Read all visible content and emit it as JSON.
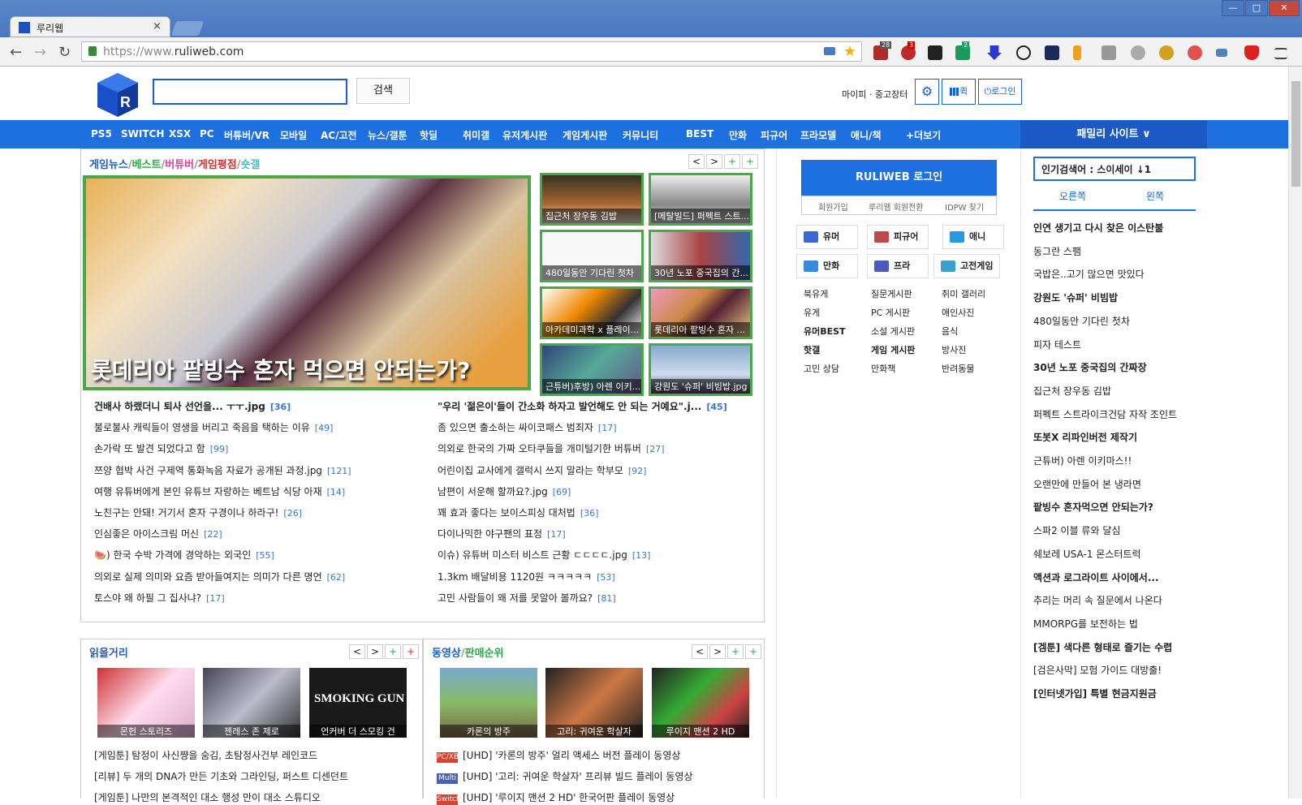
{
  "browser": {
    "tab_title": "루리웹",
    "tab_close": "×",
    "url_prefix": "https://www.",
    "url_domain": "ruliweb.com",
    "back": "←",
    "forward": "→",
    "reload": "↻",
    "star": "★",
    "win_min": "—",
    "win_max": "□",
    "win_close": "✕",
    "ext_badges": [
      "28",
      "3",
      "2"
    ]
  },
  "header": {
    "search_button": "검색",
    "search_placeholder": "",
    "mypi": "마이피 · 중고장터",
    "settings_icon": "⚙",
    "quick_label": "퀵",
    "login_label": "로그인"
  },
  "menu": {
    "items": [
      "PS5",
      "SWITCH",
      "XSX",
      "PC",
      "버튜버/VR",
      "모바일",
      "AC/고전",
      "뉴스/갤툰",
      "핫딜",
      "취미갤",
      "유저게시판",
      "게임게시판",
      "커뮤니티",
      "BEST",
      "만화",
      "피규어",
      "프라모델",
      "애니/책",
      "+더보기"
    ],
    "family": "패밀리 사이트 ∨"
  },
  "main": {
    "crumbs": [
      {
        "label": "게임뉴스",
        "color": "#1a5fd1"
      },
      {
        "label": "베스트",
        "color": "#2fa84a"
      },
      {
        "label": "버튜버",
        "color": "#e0409a"
      },
      {
        "label": "게임평점",
        "color": "#e02a2a"
      },
      {
        "label": "숏갤",
        "color": "#40c0c0"
      }
    ],
    "pager": [
      "<",
      ">",
      "+",
      "+"
    ],
    "hero_caption": "롯데리아 팥빙수 혼자 먹으면 안되는가?",
    "thumbs": [
      "집근처 장우동 김밥",
      "[메탈빌드] 퍼펙트 스트...",
      "480일동안 기다린 첫차",
      "30년 노포 중국집의 간...",
      "아카데미과학 x 플레이...",
      "롯데리아 팥빙수 혼자 ...",
      "근튜버)후방) 아렌 이키...",
      "강원도 '슈퍼' 비빔밥.jpg"
    ],
    "news_left": [
      {
        "t": "건배사 하랬더니 퇴사 선언을... ㅜㅜ.jpg",
        "c": "[36]",
        "bold": true
      },
      {
        "t": "불로불사 캐릭들이 영생을 버리고 죽음을 택하는 이유",
        "c": "[49]"
      },
      {
        "t": "손가락 또 발견 되었다고 함",
        "c": "[99]"
      },
      {
        "t": "쯔양 협박 사건 구제역 통화녹음 자료가 공개된 과정.jpg",
        "c": "[121]"
      },
      {
        "t": "여행 유튜버에게 본인 유튜브 자랑하는 베트남 식당 아재",
        "c": "[14]"
      },
      {
        "t": "노친구는 안돼! 거기서 혼자 구경이나 하라구!",
        "c": "[26]"
      },
      {
        "t": "인심좋은 아이스크림 머신",
        "c": "[22]"
      },
      {
        "t": "🍉) 한국 수박 가격에 경악하는 외국인",
        "c": "[55]"
      },
      {
        "t": "의외로 실제 의미와 요즘 받아들여지는 의미가 다른 명언",
        "c": "[62]"
      },
      {
        "t": "토스야 왜 하필 그 집사냐?",
        "c": "[17]"
      }
    ],
    "news_right": [
      {
        "t": "\"우리 '젊은이'들이 간소화 하자고 발언해도 안 되는 거예요\".j...",
        "c": "[45]",
        "bold": true
      },
      {
        "t": "좀 있으면 출소하는 싸이코패스 범죄자",
        "c": "[17]"
      },
      {
        "t": "의외로 한국의 가짜 오타쿠들을 개미털기한 버튜버",
        "c": "[27]"
      },
      {
        "t": "어린이집 교사에게 갤럭시 쓰지 말라는 학부모",
        "c": "[92]"
      },
      {
        "t": "남편이 서운해 할까요?.jpg",
        "c": "[69]"
      },
      {
        "t": "꽤 효과 좋다는 보이스피싱 대처법",
        "c": "[36]"
      },
      {
        "t": "다이나믹한 야구팬의 표정",
        "c": "[17]"
      },
      {
        "t": "이슈) 유튜버 미스터 비스트 근황 ㄷㄷㄷㄷ.jpg",
        "c": "[13]"
      },
      {
        "t": "1.3km 배달비용 1120원 ㅋㅋㅋㅋㅋ",
        "c": "[53]"
      },
      {
        "t": "고민 사람들이 왜 저를 못알아 볼까요?",
        "c": "[81]"
      }
    ]
  },
  "reading": {
    "title": "읽을거리",
    "pager": [
      "<",
      ">",
      "+",
      "+"
    ],
    "pics": [
      "몬헌 스토리즈",
      "젠레스 존 제로",
      "언커버 더 스모킹 건"
    ],
    "lines": [
      "[게임툰] 탐정이 사신쨩을 숨김, 초탐정사건부 레인코드",
      "[리뷰] 두 개의 DNA가 만든 기초와 그라인딩, 퍼스트 디센던트",
      "[게임툰] 나만의 본격적인 대소 행성 만이 대소 스튜디오"
    ]
  },
  "video": {
    "title_a": "동영상",
    "title_b": "판매순위",
    "pager": [
      "<",
      ">",
      "+",
      "+"
    ],
    "pics": [
      "카론의 방주",
      "고리: 귀여운 학살자",
      "루이지 맨션 2 HD"
    ],
    "lines": [
      {
        "tag": "PC/XB",
        "color": "#e0402a",
        "t": "[UHD] '카론의 방주' 얼리 액세스 버전 플레이 동영상"
      },
      {
        "tag": "Multi",
        "color": "#4a60b8",
        "t": "[UHD] '고리: 귀여운 학살자' 프리뷰 빌드 플레이 동영상"
      },
      {
        "tag": "Switch",
        "color": "#e0402a",
        "t": "[UHD] '루이지 맨션 2 HD' 한국어판 플레이 동영상"
      }
    ]
  },
  "sidebar": {
    "login_button": "RULIWEB 로그인",
    "login_sub": [
      "회원가입",
      "루리웹 회원전환",
      "IDPW 찾기"
    ],
    "quick": [
      "유머",
      "피규어",
      "애니",
      "만화",
      "프라",
      "고전게임"
    ],
    "links": [
      [
        "북유게",
        "질문게시판",
        "취미 갤러리"
      ],
      [
        "유게",
        "PC 게시판",
        "애인사진"
      ],
      [
        "유머BEST",
        "소설 게시판",
        "음식"
      ],
      [
        "핫갤",
        "게임 게시판",
        "방사진"
      ],
      [
        "고민 상담",
        "만화책",
        "반려동물"
      ]
    ]
  },
  "right": {
    "popular": "인기검색어 : 스이세이 ↓1",
    "tabs": [
      "오른쪽",
      "왼쪽"
    ],
    "items": [
      {
        "t": "인연 생기고 다시 찾은 이스탄불",
        "b": true
      },
      {
        "t": "동그란 스팸",
        "b": false
      },
      {
        "t": "국밥은..고기 많으면 맛있다",
        "b": false
      },
      {
        "t": "강원도 '슈퍼' 비빔밥",
        "b": true
      },
      {
        "t": "480일동안 기다린 첫차",
        "b": false
      },
      {
        "t": "피자 테스트",
        "b": false
      },
      {
        "t": "30년 노포 중국집의 간짜장",
        "b": true
      },
      {
        "t": "집근처 장우동 김밥",
        "b": false
      },
      {
        "t": "퍼펙트 스트라이크건담 자작 조인트",
        "b": false
      },
      {
        "t": "또봇X 리파인버전 제작기",
        "b": true
      },
      {
        "t": "근튜버) 아렌 이키마스!!",
        "b": false
      },
      {
        "t": "오랜만에 만들어 본 냉라면",
        "b": false
      },
      {
        "t": "팥빙수 혼자먹으면 안되는가?",
        "b": true
      },
      {
        "t": "스파2 이블 류와 달심",
        "b": false
      },
      {
        "t": "쉐보레 USA-1 몬스터트럭",
        "b": false
      },
      {
        "t": "액션과 로그라이트 사이에서...",
        "b": true
      },
      {
        "t": "추리는 머리 속 질문에서 나온다",
        "b": false
      },
      {
        "t": "MMORPG를 보전하는 법",
        "b": false
      },
      {
        "t": "[겜툰] 색다른 형태로 즐기는 수렵",
        "b": true
      },
      {
        "t": "[검은사막] 모험 가이드 대방출!",
        "b": false
      },
      {
        "t": "[인터넷가입] 특별 현금지원금",
        "b": true
      }
    ]
  },
  "colors": {
    "accent": "#1e6fe0",
    "green_border": "#4aa84a",
    "count": "#3a76c8"
  }
}
